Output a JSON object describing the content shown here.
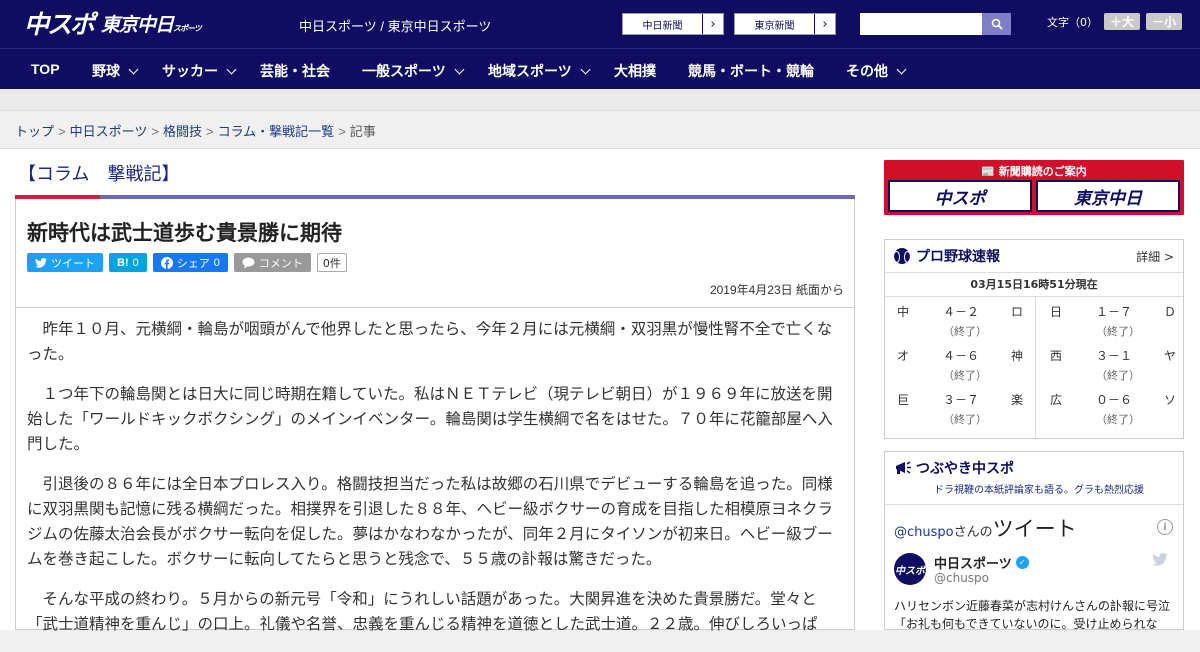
{
  "header": {
    "logo_chu": "中スポ",
    "logo_tokyo": "東京中日",
    "logo_tokyo_small": "スポーツ",
    "site_names": "中日スポーツ / 東京中日スポーツ",
    "paper_links": [
      "中日新聞",
      "東京新聞"
    ],
    "search_placeholder": "",
    "text_size_label": "文字（0）",
    "text_bigger": "＋大",
    "text_smaller": "－小"
  },
  "nav": {
    "items": [
      {
        "label": "TOP",
        "dropdown": false
      },
      {
        "label": "野球",
        "dropdown": true
      },
      {
        "label": "サッカー",
        "dropdown": true
      },
      {
        "label": "芸能・社会",
        "dropdown": false
      },
      {
        "label": "一般スポーツ",
        "dropdown": true
      },
      {
        "label": "地域スポーツ",
        "dropdown": true
      },
      {
        "label": "大相撲",
        "dropdown": false
      },
      {
        "label": "競馬・ボート・競輪",
        "dropdown": false
      },
      {
        "label": "その他",
        "dropdown": true
      }
    ]
  },
  "breadcrumb": {
    "items": [
      "トップ",
      "中日スポーツ",
      "格闘技",
      "コラム・撃戦記一覧"
    ],
    "current": "記事",
    "sep": ">"
  },
  "article": {
    "column_title": "【コラム　撃戦記】",
    "headline": "新時代は武士道歩む貴景勝に期待",
    "social": {
      "tweet": "ツイート",
      "hatena": "B!",
      "hatena_count": "0",
      "share": "シェア",
      "share_count": "0",
      "comment": "コメント",
      "comment_count": "0件"
    },
    "dateline": "2019年4月23日 紙面から",
    "paragraphs": [
      "昨年１０月、元横綱・輪島が咽頭がんで他界したと思ったら、今年２月には元横綱・双羽黒が慢性腎不全で亡くなった。",
      "１つ年下の輪島関とは日大に同じ時期在籍していた。私はＮＥＴテレビ（現テレビ朝日）が１９６９年に放送を開始した「ワールドキックボクシング」のメインイベンター。輪島関は学生横綱で名をはせた。７０年に花籠部屋へ入門した。",
      "引退後の８６年には全日本プロレス入り。格闘技担当だった私は故郷の石川県でデビューする輪島を追った。同様に双羽黒関も記憶に残る横綱だった。相撲界を引退した８８年、ヘビー級ボクサーの育成を目指した相模原ヨネクラジムの佐藤太治会長がボクサー転向を促した。夢はかなわなかったが、同年２月にタイソンが初来日。ヘビー級ブームを巻き起こした。ボクサーに転向してたらと思うと残念で、５５歳の訃報は驚きだった。",
      "そんな平成の終わり。５月からの新元号「令和」にうれしい話題があった。大関昇進を決めた貴景勝だ。堂々と「武士道精神を重んじ」の口上。礼儀や名誉、忠義を重んじる精神を道徳とした武士道。２２歳。伸びしろいっぱ"
    ]
  },
  "sidebar": {
    "subscribe": {
      "caption": "新聞購読のご案内",
      "left": "中スポ",
      "right": "東京中日"
    },
    "scores": {
      "title": "プロ野球速報",
      "detail": "詳細 >",
      "time": "03月15日16時51分現在",
      "games": [
        {
          "home": "中",
          "score": "４－２",
          "away": "ロ",
          "status": "（終了）"
        },
        {
          "home": "日",
          "score": "１－７",
          "away": "Ｄ",
          "status": "（終了）"
        },
        {
          "home": "オ",
          "score": "４－６",
          "away": "神",
          "status": "（終了）"
        },
        {
          "home": "西",
          "score": "３－１",
          "away": "ヤ",
          "status": "（終了）"
        },
        {
          "home": "巨",
          "score": "３－７",
          "away": "楽",
          "status": "（終了）"
        },
        {
          "home": "広",
          "score": "０－６",
          "away": "ソ",
          "status": "（終了）"
        }
      ]
    },
    "tweets": {
      "title": "つぶやき中スポ",
      "subtitle": "ドラ視鞭の本紙評論家も語る。グラも熱烈応援",
      "handle_link": "@chuspo",
      "handle_suffix": "さんの",
      "heading": "ツイート",
      "account_name": "中日スポーツ",
      "account_handle": "@chuspo",
      "avatar_text": "中スポ",
      "text": "ハリセンボン近藤春菜が志村けんさんの訃報に号泣「お礼も何もできていないのに。受け止められな"
    }
  }
}
